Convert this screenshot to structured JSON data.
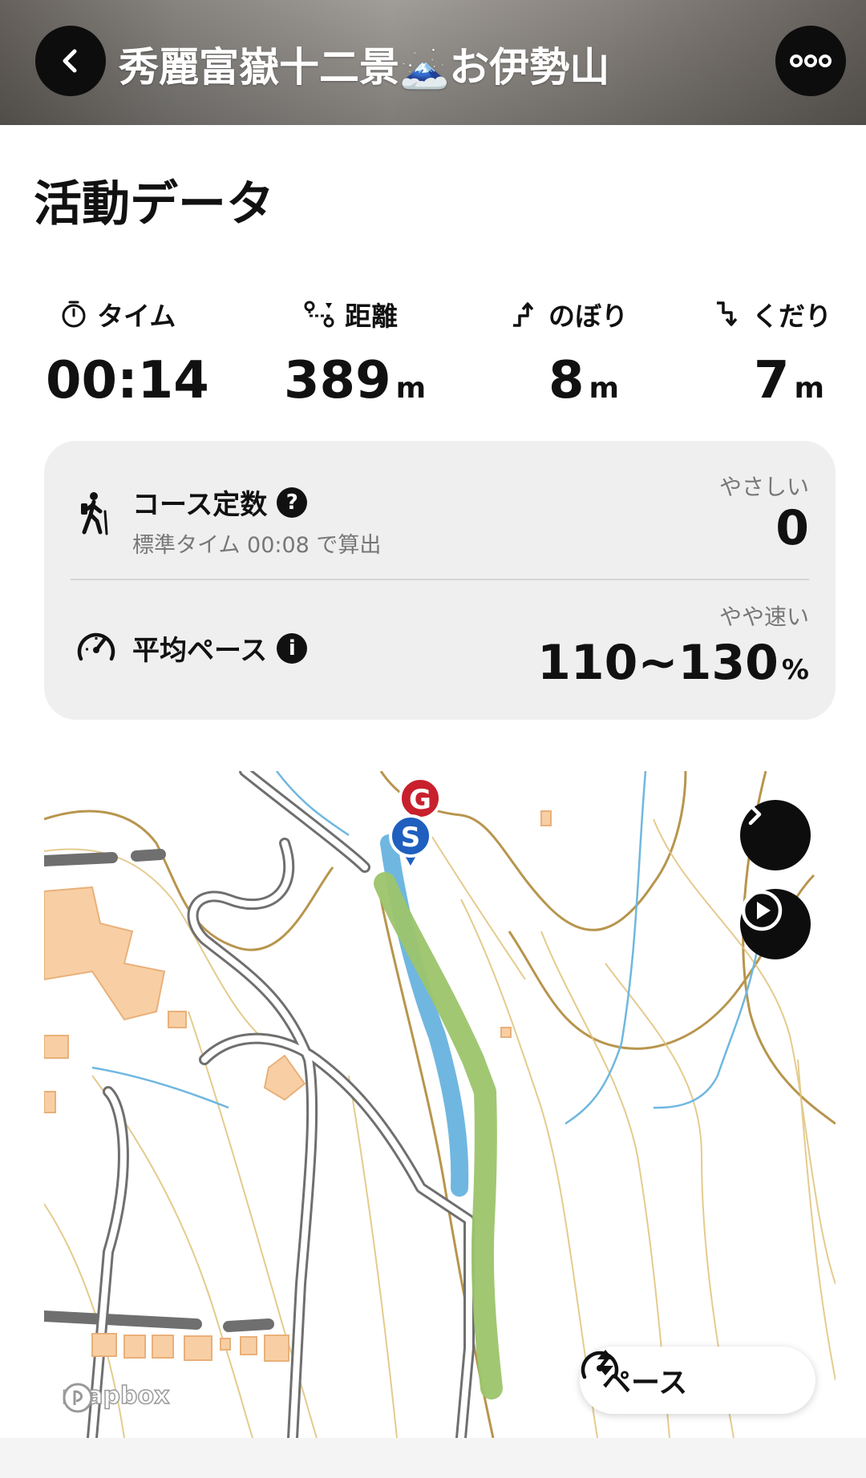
{
  "header": {
    "title": "秀麗富嶽十二景🗻お伊勢山"
  },
  "section_title": "活動データ",
  "stats": [
    {
      "label": "タイム",
      "value": "00:14",
      "unit": "",
      "icon": "stopwatch-icon"
    },
    {
      "label": "距離",
      "value": "389",
      "unit": "m",
      "icon": "route-icon"
    },
    {
      "label": "のぼり",
      "value": "8",
      "unit": "m",
      "icon": "ascent-icon"
    },
    {
      "label": "くだり",
      "value": "7",
      "unit": "m",
      "icon": "descent-icon"
    }
  ],
  "course": {
    "title": "コース定数",
    "sub": "標準タイム 00:08 で算出",
    "level": "やさしい",
    "value": "0"
  },
  "pace": {
    "title": "平均ペース",
    "level": "やや速い",
    "value": "110~130",
    "unit": "%"
  },
  "map": {
    "start_marker": "S",
    "goal_marker": "G",
    "pace_toggle_label": "ペース",
    "attribution": "mapbox",
    "colors": {
      "route": "#9cc46b",
      "stream": "#6fb7e0",
      "contour": "#b08a3a",
      "building": "#f8cfa4",
      "road": "#6f6f6f"
    }
  }
}
